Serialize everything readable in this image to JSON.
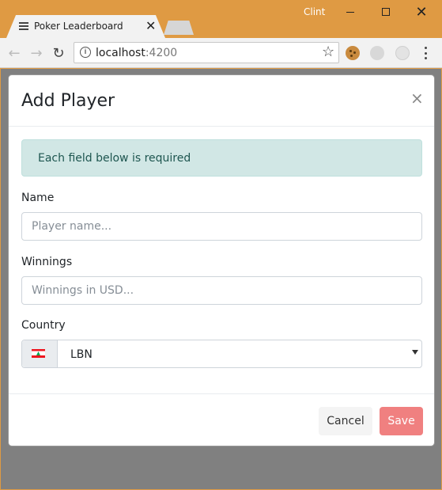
{
  "browser": {
    "tab_title": "Poker Leaderboard",
    "tab_close": "✕",
    "user_name": "Clint",
    "url_host": "localhost",
    "url_port": ":4200",
    "nav_back": "←",
    "nav_forward": "→",
    "nav_reload": "↻",
    "bookmark_star": "☆",
    "window_close": "✕",
    "info_glyph": "i"
  },
  "modal": {
    "title": "Add Player",
    "close_label": "×",
    "alert_text": "Each field below is required",
    "fields": {
      "name_label": "Name",
      "name_placeholder": "Player name...",
      "winnings_label": "Winnings",
      "winnings_placeholder": "Winnings in USD...",
      "country_label": "Country",
      "country_value": "LBN"
    },
    "footer": {
      "cancel_label": "Cancel",
      "save_label": "Save"
    }
  },
  "colors": {
    "window_frame": "#df9a43",
    "backdrop": "#808080",
    "alert_bg": "#d1e7e5",
    "save_button": "#f08080"
  }
}
